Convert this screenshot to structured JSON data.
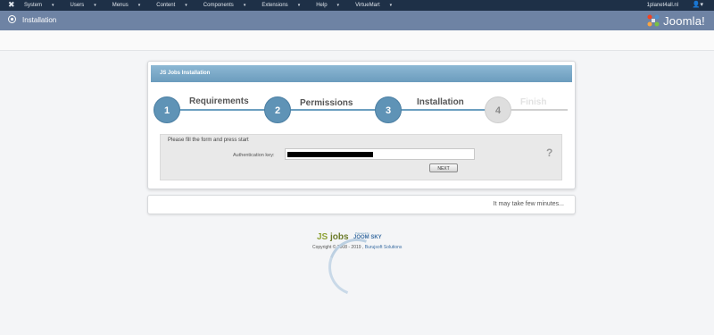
{
  "topbar": {
    "menu": [
      "System",
      "Users",
      "Menus",
      "Content",
      "Components",
      "Extensions",
      "Help",
      "VirtueMart"
    ],
    "user": "1planet4all.nl"
  },
  "titlebar": {
    "title": "Installation",
    "logo_text": "Joomla!"
  },
  "panel": {
    "heading": "JS Jobs Installation",
    "steps": [
      {
        "number": "1",
        "label": "Requirements",
        "active": true
      },
      {
        "number": "2",
        "label": "Permissions",
        "active": true
      },
      {
        "number": "3",
        "label": "Installation",
        "active": true
      },
      {
        "number": "4",
        "label": "Finish",
        "active": false
      }
    ],
    "form": {
      "intro": "Please fill the form and press start",
      "auth_label": "Authentication key:",
      "next_label": "NEXT",
      "help": "?"
    }
  },
  "notice": {
    "message": "It may take few minutes..."
  },
  "credit": {
    "js": "JS",
    "jobs": "jobs",
    "powered": "Powered by",
    "joomsky": "JOOM SKY",
    "copyright": "Copyright © 2008 - 2019 ,",
    "company": "Burujsoft Solutions"
  },
  "colors": {
    "topbar": "#1e3047",
    "titlebar": "#6e83a4",
    "step_active": "#5f93b6",
    "step_disabled": "#dedede"
  }
}
